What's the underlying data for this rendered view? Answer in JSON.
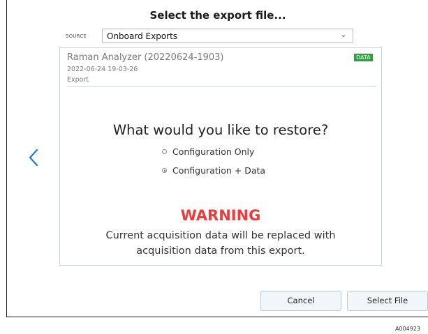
{
  "dialog": {
    "title": "Select the export file...",
    "source_label": "SOURCE",
    "source_value": "Onboard Exports"
  },
  "export_card": {
    "name": "Raman Analyzer (20220624-1903)",
    "date": "2022-06-24 19-03-26",
    "type": "Export",
    "badge": "DATA",
    "badge_color": "#2e9e3e"
  },
  "restore": {
    "question": "What would you like to restore?",
    "options": [
      {
        "label": "Configuration Only",
        "selected": false
      },
      {
        "label": "Configuration + Data",
        "selected": true
      }
    ]
  },
  "warning": {
    "title": "WARNING",
    "line1": "Current acquisition data will be replaced with",
    "line2": "acquisition data from this export.",
    "color": "#ee3b3b"
  },
  "buttons": {
    "cancel": "Cancel",
    "select_file": "Select File"
  },
  "icons": {
    "back": "chevron-left-icon",
    "dropdown": "chevron-down-icon"
  },
  "figure_id": "A004923"
}
